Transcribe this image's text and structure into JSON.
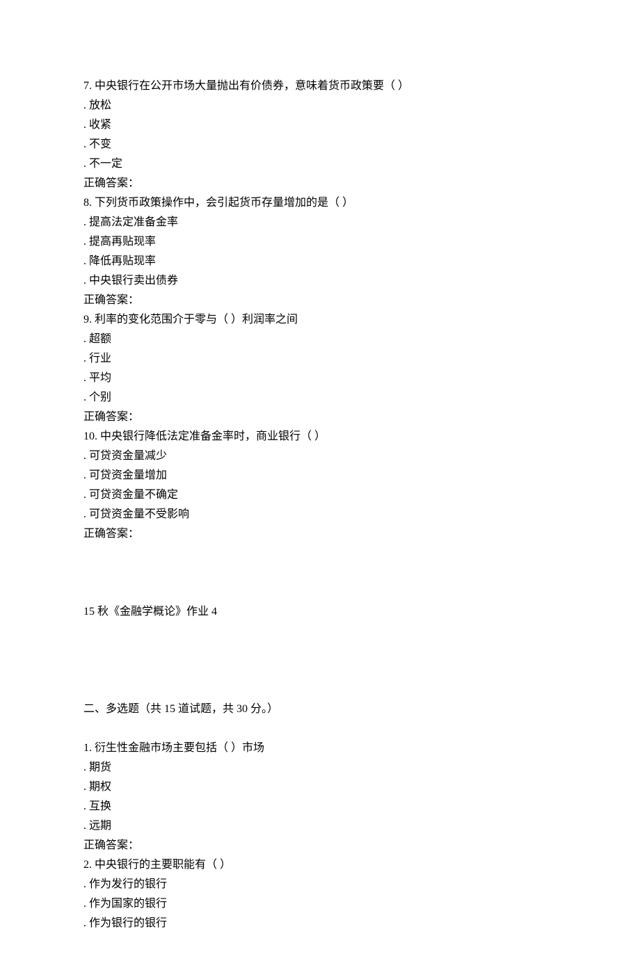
{
  "questions_part1": [
    {
      "num": "7.",
      "stem": "中央银行在公开市场大量抛出有价债券，意味着货币政策要（ ）",
      "options": [
        "放松",
        "收紧",
        "不变",
        "不一定"
      ],
      "answer_label": "正确答案："
    },
    {
      "num": "8.",
      "stem": "下列货币政策操作中，会引起货币存量增加的是（ ）",
      "options": [
        "提高法定准备金率",
        "提高再贴现率",
        "降低再贴现率",
        "中央银行卖出债券"
      ],
      "answer_label": "正确答案："
    },
    {
      "num": "9.",
      "stem": "利率的变化范围介于零与（ ）利润率之间",
      "options": [
        "超额",
        "行业",
        "平均",
        "个别"
      ],
      "answer_label": "正确答案："
    },
    {
      "num": "10.",
      "stem": "中央银行降低法定准备金率时，商业银行（ ）",
      "options": [
        "可贷资金量减少",
        "可贷资金量增加",
        "可贷资金量不确定",
        "可贷资金量不受影响"
      ],
      "answer_label": "正确答案："
    }
  ],
  "section_title": "15 秋《金融学概论》作业 4",
  "section_header": "二、多选题（共 15 道试题，共 30 分。）",
  "questions_part2": [
    {
      "num": "1.",
      "stem": "衍生性金融市场主要包括（ ）市场",
      "options": [
        "期货",
        "期权",
        "互换",
        "远期"
      ],
      "answer_label": "正确答案："
    },
    {
      "num": "2.",
      "stem": "中央银行的主要职能有（ ）",
      "options": [
        "作为发行的银行",
        "作为国家的银行",
        "作为银行的银行"
      ],
      "answer_label": ""
    }
  ]
}
